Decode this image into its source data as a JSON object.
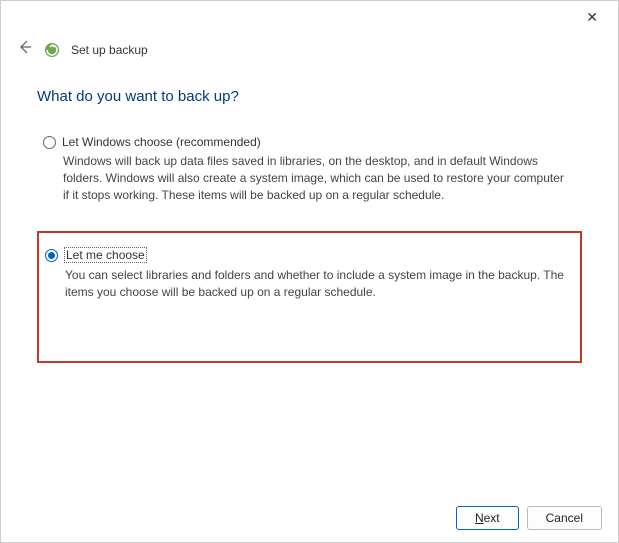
{
  "window": {
    "title": "Set up backup"
  },
  "page": {
    "heading": "What do you want to back up?"
  },
  "options": {
    "windows_choose": {
      "label": "Let Windows choose (recommended)",
      "desc": "Windows will back up data files saved in libraries, on the desktop, and in default Windows folders. Windows will also create a system image, which can be used to restore your computer if it stops working. These items will be backed up on a regular schedule.",
      "selected": false
    },
    "let_me_choose": {
      "label": "Let me choose",
      "desc": "You can select libraries and folders and whether to include a system image in the backup. The items you choose will be backed up on a regular schedule.",
      "selected": true
    }
  },
  "buttons": {
    "next": "Next",
    "cancel": "Cancel"
  }
}
